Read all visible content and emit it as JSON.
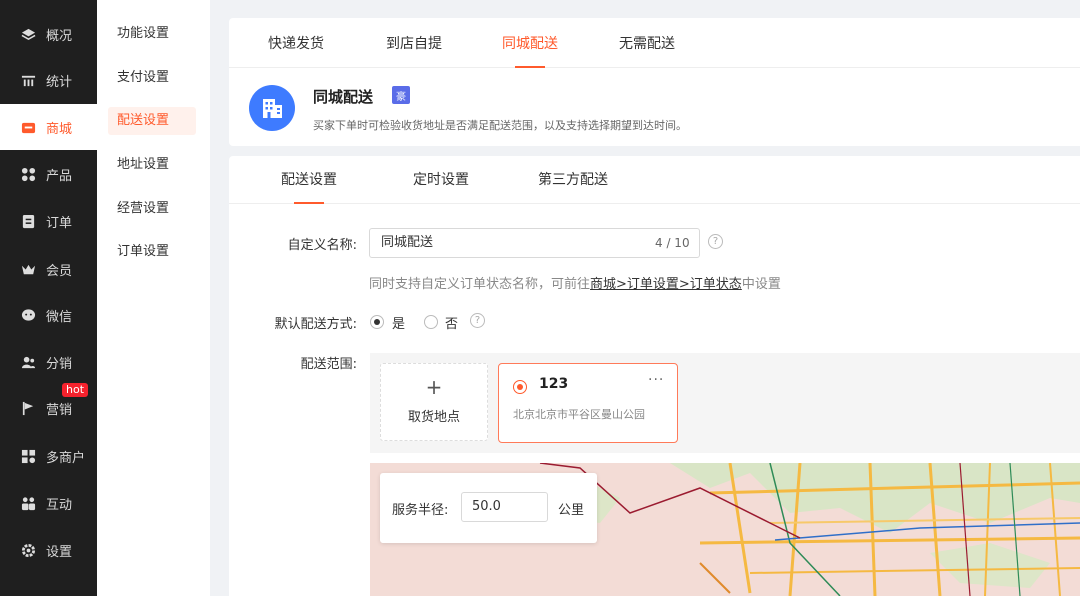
{
  "main_menu": [
    {
      "label": "概况",
      "icon": "layers-icon",
      "active": false
    },
    {
      "label": "统计",
      "icon": "chart-icon",
      "active": false
    },
    {
      "label": "商城",
      "icon": "shop-icon",
      "active": true
    },
    {
      "label": "产品",
      "icon": "grid-icon",
      "active": false
    },
    {
      "label": "订单",
      "icon": "clipboard-icon",
      "active": false
    },
    {
      "label": "会员",
      "icon": "crown-icon",
      "active": false
    },
    {
      "label": "微信",
      "icon": "chat-icon",
      "active": false
    },
    {
      "label": "分销",
      "icon": "users-icon",
      "active": false
    },
    {
      "label": "营销",
      "icon": "flag-icon",
      "active": false,
      "badge": "hot"
    },
    {
      "label": "多商户",
      "icon": "store-icon",
      "active": false
    },
    {
      "label": "互动",
      "icon": "people-icon",
      "active": false
    },
    {
      "label": "设置",
      "icon": "gear-icon",
      "active": false
    }
  ],
  "sub_menu": [
    {
      "label": "功能设置",
      "active": false
    },
    {
      "label": "支付设置",
      "active": false
    },
    {
      "label": "配送设置",
      "active": true
    },
    {
      "label": "地址设置",
      "active": false
    },
    {
      "label": "经营设置",
      "active": false
    },
    {
      "label": "订单设置",
      "active": false
    }
  ],
  "top_tabs": [
    {
      "label": "快递发货",
      "active": false
    },
    {
      "label": "到店自提",
      "active": false
    },
    {
      "label": "同城配送",
      "active": true
    },
    {
      "label": "无需配送",
      "active": false
    }
  ],
  "feature": {
    "title": "同城配送",
    "badge": "豪",
    "description": "买家下单时可检验收货地址是否满足配送范围，以及支持选择期望到达时间。",
    "icon": "building-icon"
  },
  "sub_tabs": [
    {
      "label": "配送设置",
      "active": true
    },
    {
      "label": "定时设置",
      "active": false
    },
    {
      "label": "第三方配送",
      "active": false
    }
  ],
  "form": {
    "name_label": "自定义名称:",
    "name_value": "同城配送",
    "name_count": "4 / 10",
    "hint_prefix": "同时支持自定义订单状态名称，可前往",
    "hint_link": "商城>订单设置>订单状态",
    "hint_suffix": "中设置",
    "default_label": "默认配送方式:",
    "option_yes": "是",
    "option_no": "否",
    "default_selected": "是",
    "range_label": "配送范围:",
    "add_symbol": "+",
    "add_label": "取货地点",
    "location": {
      "name": "123",
      "address": "北京北京市平谷区曼山公园",
      "more": "···"
    },
    "radius_label": "服务半径:",
    "radius_value": "50.0",
    "radius_unit": "公里"
  },
  "help_symbol": "?",
  "colors": {
    "accent": "#ff5a2c",
    "sidebar_bg": "#1f1f1f",
    "feature_icon_bg": "#3e7bff",
    "badge_bg": "#5a6ce8",
    "hot_badge": "#f5222d"
  }
}
